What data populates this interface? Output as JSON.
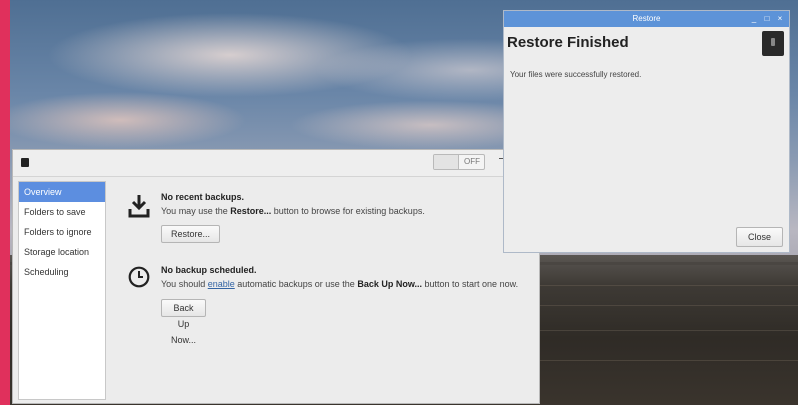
{
  "main": {
    "toggle_label": "OFF",
    "sidebar": [
      {
        "label": "Overview"
      },
      {
        "label": "Folders to save"
      },
      {
        "label": "Folders to ignore"
      },
      {
        "label": "Storage location"
      },
      {
        "label": "Scheduling"
      }
    ],
    "backups": {
      "title": "No recent backups.",
      "desc_prefix": "You may use the ",
      "desc_bold": "Restore...",
      "desc_suffix": " button to browse for existing backups.",
      "button": "Restore..."
    },
    "schedule": {
      "title": "No backup scheduled.",
      "desc_prefix": "You should ",
      "desc_link": "enable",
      "desc_mid": " automatic backups or use the ",
      "desc_bold": "Back Up Now...",
      "desc_suffix": " button to start one now.",
      "button": "Back Up Now..."
    }
  },
  "dialog": {
    "title": "Restore",
    "heading": "Restore Finished",
    "message": "Your files were successfully restored.",
    "close_label": "Close",
    "controls": {
      "minimize": "_",
      "maximize": "□",
      "close": "×"
    }
  },
  "colors": {
    "accent": "#e0305c",
    "title_bar": "#5d93d8",
    "sidebar_selected": "#5c8ee0",
    "link": "#3465a4"
  }
}
